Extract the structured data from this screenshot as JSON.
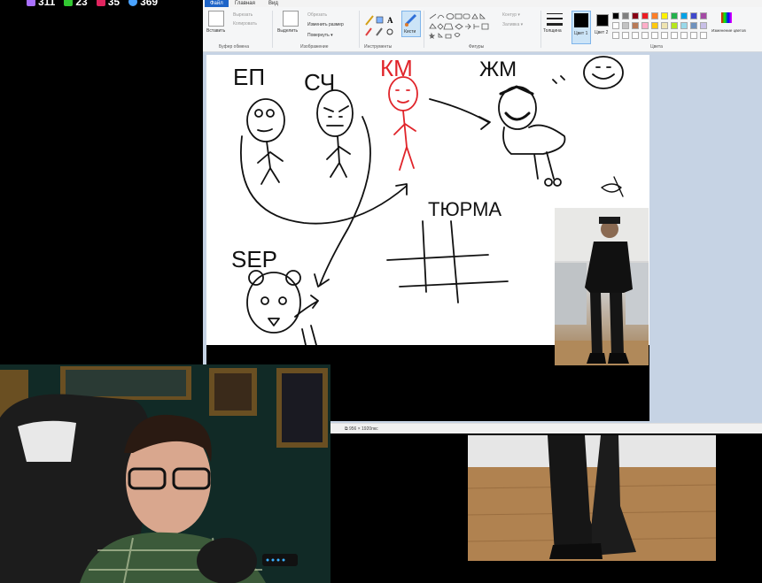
{
  "stream_stats": [
    {
      "value": "311",
      "icon": "twitch-icon",
      "color": "#a970ff"
    },
    {
      "value": "23",
      "icon": "star-icon",
      "color": "#32c832"
    },
    {
      "value": "35",
      "icon": "bot-icon",
      "color": "#e0245e"
    },
    {
      "value": "369",
      "icon": "viewers-icon",
      "color": "#4aa3ff"
    }
  ],
  "paint": {
    "menu": [
      "Файл",
      "Главная",
      "Вид"
    ],
    "clipboard": {
      "paste": "Вставить",
      "cut": "Вырезать",
      "copy": "Копировать",
      "label": "Буфер обмена"
    },
    "image": {
      "select": "Выделить",
      "crop": "Обрезать",
      "resize": "Изменить размер",
      "rotate": "Повернуть ▾",
      "label": "Изображение"
    },
    "tools": {
      "label": "Инструменты",
      "brushes": "Кисти"
    },
    "shapes": {
      "outline": "Контур ▾",
      "fill": "Заливка ▾",
      "label": "Фигуры"
    },
    "size": "Толщина",
    "color1": "Цвет 1",
    "color2": "Цвет 2",
    "edit_colors": "Изменение цветов",
    "colors_label": "Цвета",
    "palette": [
      "#000000",
      "#7f7f7f",
      "#880015",
      "#ed1c24",
      "#ff7f27",
      "#fff200",
      "#22b14c",
      "#00a2e8",
      "#3f48cc",
      "#a349a4",
      "#ffffff",
      "#c3c3c3",
      "#b97a57",
      "#ffaec9",
      "#ffc90e",
      "#efe4b0",
      "#b5e61d",
      "#99d9ea",
      "#7092be",
      "#c8bfe7"
    ],
    "status": "956 × 1920пкс"
  },
  "drawing": {
    "label_ep": "ЕП",
    "label_sch": "СЧ",
    "label_km": "КМ",
    "label_zhm": "ЖМ",
    "label_ser": "SЕР",
    "label_prison": "ТЮРМА"
  }
}
